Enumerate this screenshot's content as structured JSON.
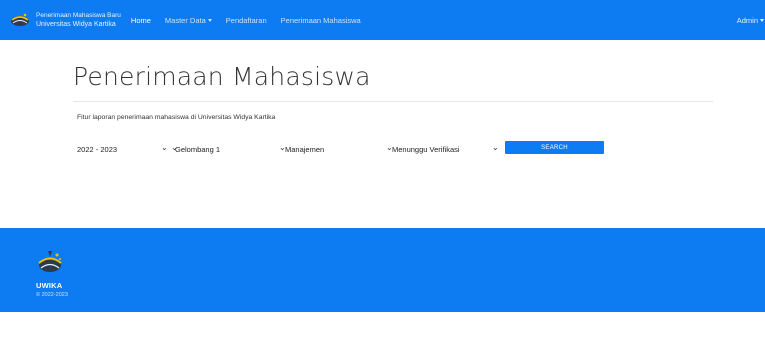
{
  "navbar": {
    "brand_line1": "Penerimaan Mahasiswa Baru",
    "brand_line2": "Universitas Widya Kartika",
    "links": [
      {
        "label": "Home"
      },
      {
        "label": "Master Data"
      },
      {
        "label": "Pendaftaran"
      },
      {
        "label": "Penerimaan Mahasiswa"
      }
    ],
    "user_label": "Admin"
  },
  "main": {
    "title": "Penerimaan Mahasiswa",
    "description": "Fitur laporan penerimaan mahasiswa di Universitas Widya Kartika",
    "filters": {
      "year": "2022 - 2023",
      "wave": "Gelombang 1",
      "program": "Manajemen",
      "status": "Menunggu Verifikasi"
    },
    "search_label": "SEARCH"
  },
  "footer": {
    "name": "UWIKA",
    "copyright": "© 2022-2023"
  },
  "colors": {
    "primary": "#0d7cf2"
  },
  "icons": {
    "logo": "uwika-logo-icon",
    "caret": "caret-down-icon",
    "chevron": "chevron-down-icon"
  }
}
